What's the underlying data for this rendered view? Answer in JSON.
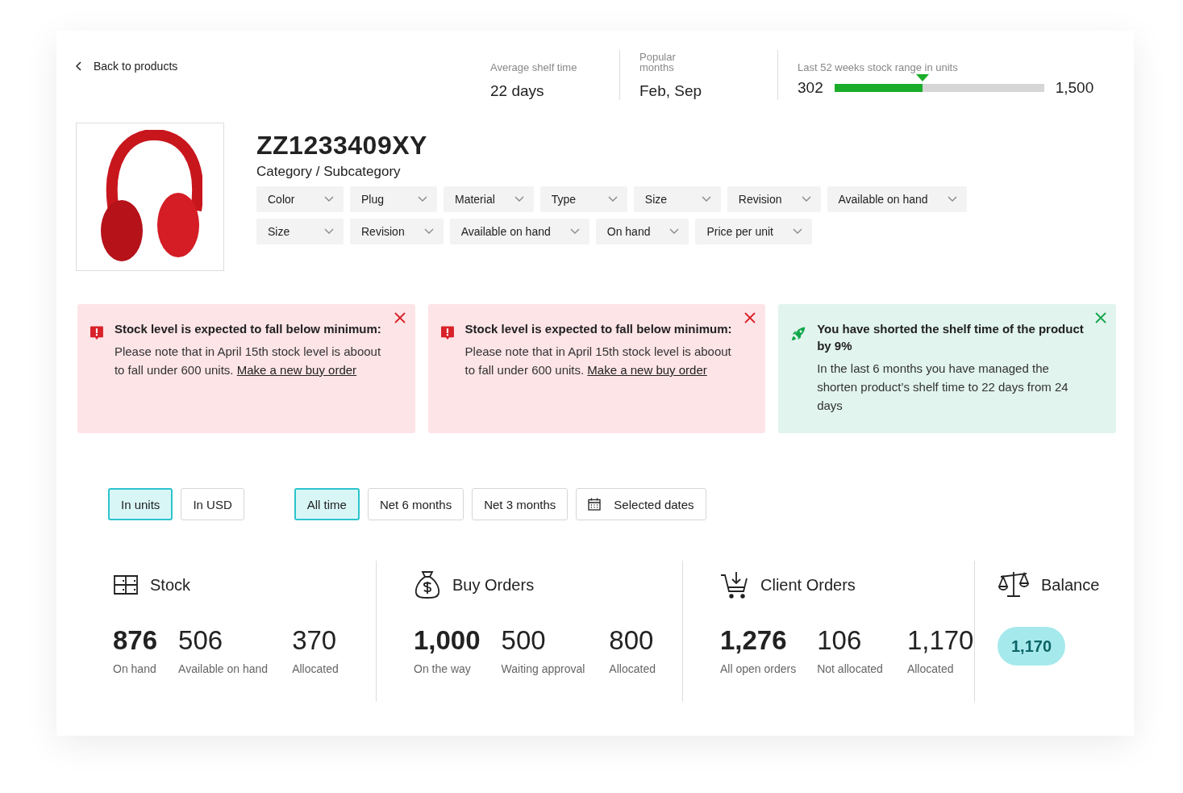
{
  "back_link": "Back to products",
  "metrics": [
    {
      "kind": "text",
      "label": "Average shelf time",
      "value": "22 days"
    },
    {
      "kind": "text",
      "label": "Popular months",
      "value": "Feb, Sep"
    },
    {
      "kind": "range",
      "label": "Last 52 weeks stock range in units",
      "min": "302",
      "max": "1,500",
      "level": 0.42
    }
  ],
  "product": {
    "code": "ZZ1233409XY",
    "category": "Category / Subcategory"
  },
  "filters": [
    [
      "Color",
      "Plug",
      "Material",
      "Type",
      "Size",
      "Revision",
      "Available on hand"
    ],
    [
      "Size",
      "Revision",
      "Available on hand",
      "On hand",
      "Price per unit"
    ]
  ],
  "alerts": [
    {
      "kind": "warning",
      "title": "Stock level is expected to fall below minimum:",
      "text": "Please note that in April 15th stock level is aboout to fall under 600 units.",
      "link": "Make a new buy order"
    },
    {
      "kind": "warning",
      "title": "Stock level is expected to fall below minimum:",
      "text": "Please note that in April 15th stock level is aboout to fall under 600 units.",
      "link": "Make a new buy order"
    },
    {
      "kind": "success",
      "title": "You have shorted the shelf time of the product by 9%",
      "text": "In the last 6 months you have managed the shorten product’s shelf time to 22 days from 24 days"
    }
  ],
  "unit_toggle": [
    {
      "label": "In units",
      "selected": true
    },
    {
      "label": "In USD",
      "selected": false
    }
  ],
  "period_toggle": [
    {
      "label": "All time",
      "selected": true,
      "kind": "plain"
    },
    {
      "label": "Net 6 months",
      "selected": false,
      "kind": "plain"
    },
    {
      "label": "Net 3 months",
      "selected": false,
      "kind": "plain"
    },
    {
      "label": "Selected dates",
      "selected": false,
      "kind": "calendar"
    }
  ],
  "sections": [
    {
      "kind": "stock",
      "title": "Stock",
      "stats": [
        {
          "value": "876",
          "label": "On hand"
        },
        {
          "value": "506",
          "label": "Available on hand"
        },
        {
          "value": "370",
          "label": "Allocated"
        }
      ]
    },
    {
      "kind": "buy",
      "title": "Buy Orders",
      "stats": [
        {
          "value": "1,000",
          "label": "On the way"
        },
        {
          "value": "500",
          "label": "Waiting approval"
        },
        {
          "value": "800",
          "label": "Allocated"
        }
      ]
    },
    {
      "kind": "client",
      "title": "Client Orders",
      "stats": [
        {
          "value": "1,276",
          "label": "All open orders"
        },
        {
          "value": "106",
          "label": "Not allocated"
        },
        {
          "value": "1,170",
          "label": "Allocated"
        }
      ]
    },
    {
      "kind": "balance",
      "title": "Balance",
      "badge": "1,170"
    }
  ]
}
